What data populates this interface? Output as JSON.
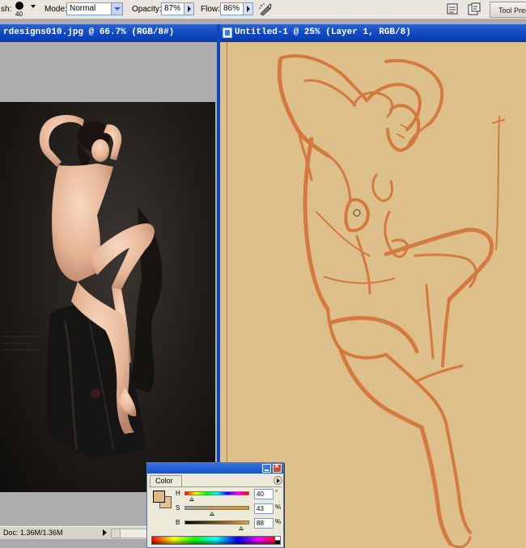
{
  "options_bar": {
    "brush_label": "sh:",
    "brush_size": "40",
    "mode_label": "Mode:",
    "mode_value": "Normal",
    "opacity_label": "Opacity:",
    "opacity_value": "87%",
    "flow_label": "Flow:",
    "flow_value": "86%",
    "tool_presets_label": "Tool Prese"
  },
  "left_document": {
    "title": "rdesigns010.jpg @ 66.7% (RGB/8#)",
    "status_doc": "Doc: 1.36M/1.36M"
  },
  "right_document": {
    "title": "Untitled-1 @ 25% (Layer 1, RGB/8)"
  },
  "color_panel": {
    "tab_label": "Color",
    "foreground_color": "#ddb880",
    "background_color": "#e2c490",
    "h_label": "H",
    "h_value": "40",
    "h_unit": "°",
    "s_label": "S",
    "s_value": "43",
    "s_unit": "%",
    "b_label": "B",
    "b_value": "88",
    "b_unit": "%"
  },
  "colors": {
    "canvas_bg": "#ddc089",
    "sketch_stroke": "#d4733a",
    "title_bar": "#0c45bd"
  }
}
